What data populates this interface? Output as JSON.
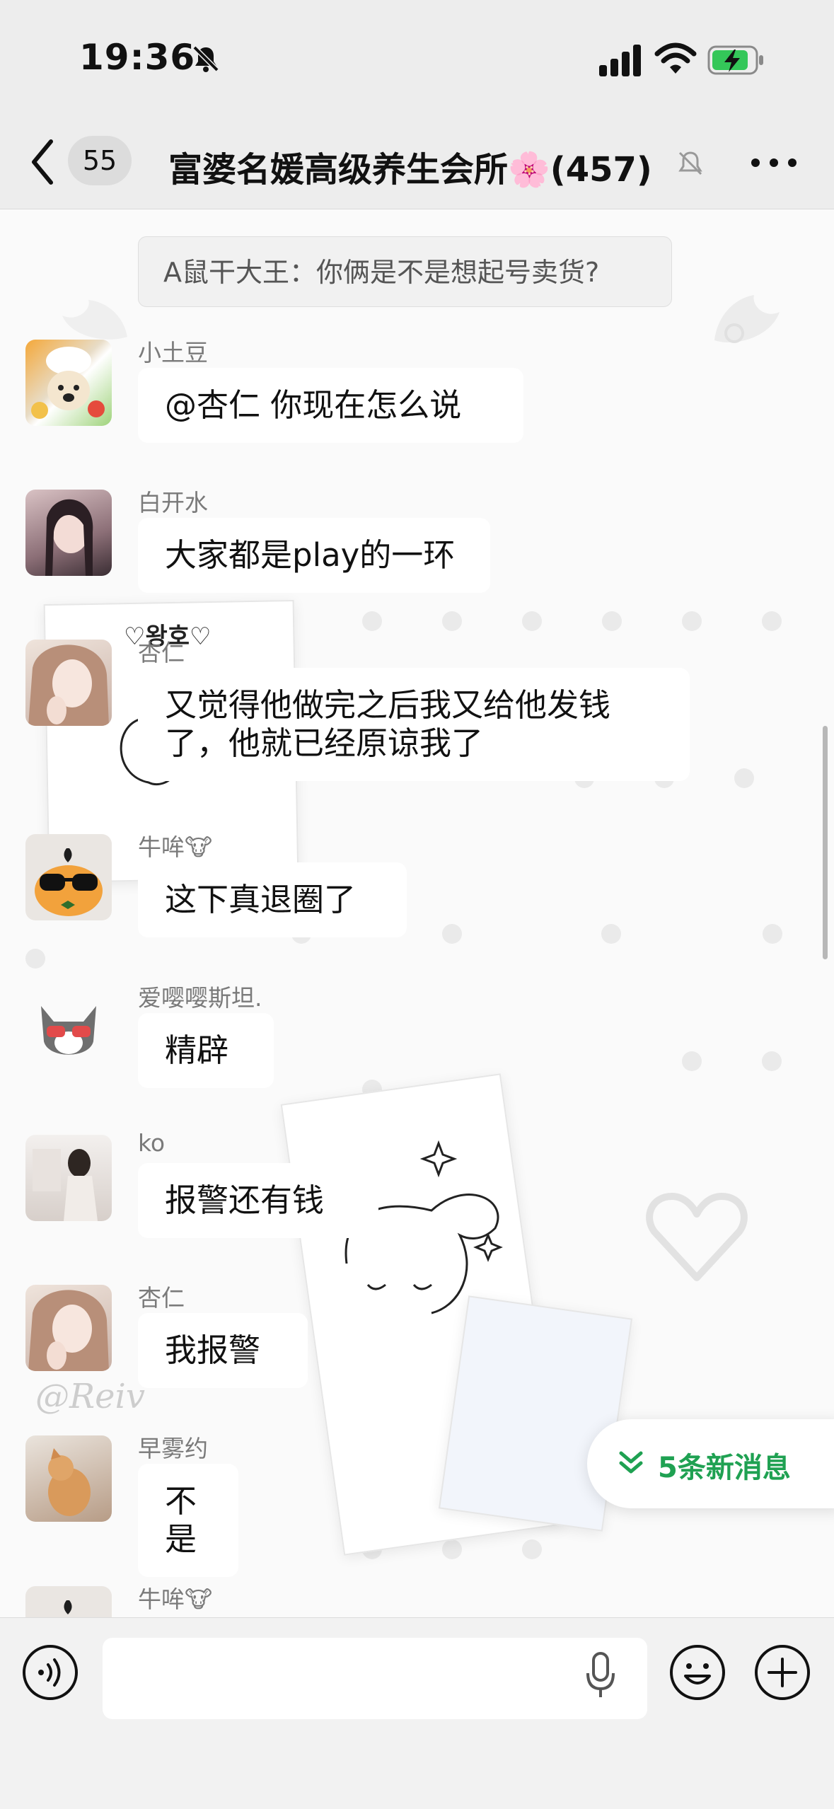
{
  "status_bar": {
    "time": "19:36"
  },
  "nav": {
    "unread_count": "55",
    "chat_title": "富婆名媛高级养生会所🌸(457)"
  },
  "chat": {
    "quoted_reply": "A鼠干大王：你俩是不是想起号卖货?",
    "sticker_text": "♡왕호♡",
    "messages": [
      {
        "sender": "小土豆",
        "text": "@杏仁 你现在怎么说"
      },
      {
        "sender": "白开水",
        "text": "大家都是play的一环"
      },
      {
        "sender": "杏仁",
        "text": "又觉得他做完之后我又给他发钱了，他就已经原谅我了"
      },
      {
        "sender": "牛哞🐮",
        "text": "这下真退圈了"
      },
      {
        "sender": "爱嘤嘤斯坦.",
        "text": "精辟"
      },
      {
        "sender": "ko",
        "text": "报警还有钱"
      },
      {
        "sender": "杏仁",
        "text": "我报警"
      },
      {
        "sender": "早雾约",
        "text": "不是"
      },
      {
        "sender": "牛哞🐮",
        "text": ""
      }
    ],
    "new_messages_label": "5条新消息",
    "watermark": "@Reiv"
  },
  "input": {
    "placeholder": ""
  },
  "colors": {
    "accent_green": "#1fa152",
    "bubble_bg": "#ffffff",
    "chat_bg": "#fafafa",
    "header_bg": "#ededed"
  }
}
